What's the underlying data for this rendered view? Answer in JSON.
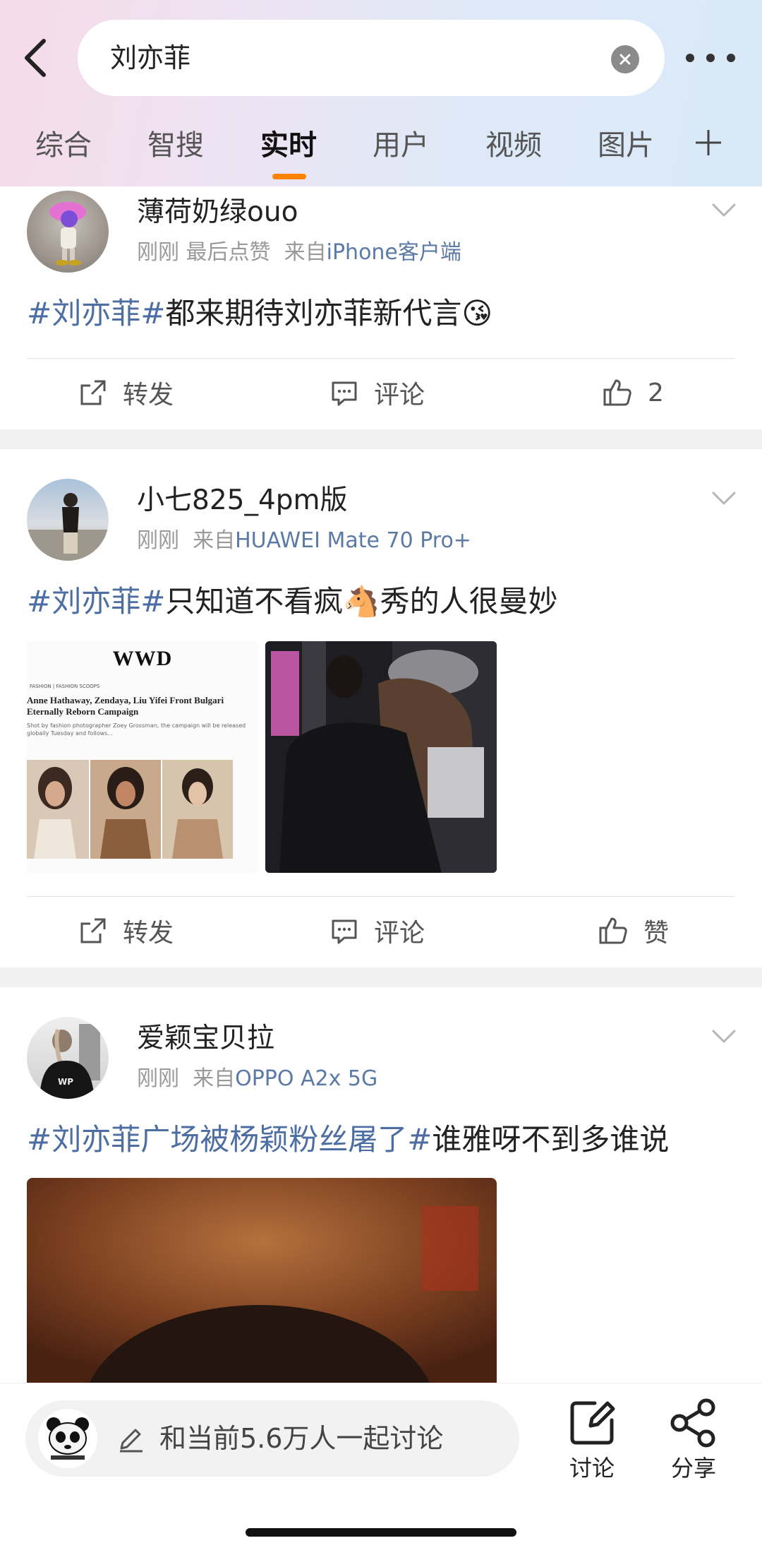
{
  "search": {
    "query": "刘亦菲"
  },
  "tabs": [
    {
      "label": "综合"
    },
    {
      "label": "智搜"
    },
    {
      "label": "实时"
    },
    {
      "label": "用户"
    },
    {
      "label": "视频"
    },
    {
      "label": "图片"
    }
  ],
  "accent_color": "#ff8200",
  "topic_color": "#4c6ea2",
  "posts": [
    {
      "username": "薄荷奶绿ouo",
      "time": "刚刚",
      "extra": "最后点赞",
      "source_prefix": "来自",
      "source": "iPhone客户端",
      "topic": "#刘亦菲#",
      "text": "都来期待刘亦菲新代言😘",
      "repost_label": "转发",
      "comment_label": "评论",
      "like_label": "2"
    },
    {
      "username": "小七825_4pm版",
      "time": "刚刚",
      "source_prefix": "来自",
      "source": "HUAWEI Mate 70 Pro+",
      "topic": "#刘亦菲#",
      "text": "只知道不看疯🐴秀的人很曼妙",
      "image1": {
        "brand": "WWD",
        "kicker": "FASHION | FASHION SCOOPS",
        "headline": "Anne Hathaway, Zendaya, Liu Yifei Front Bulgari Eternally Reborn Campaign",
        "dek": "Shot by fashion photographer Zoey Grossman, the campaign will be released globally Tuesday and follows..."
      },
      "repost_label": "转发",
      "comment_label": "评论",
      "like_label": "赞"
    },
    {
      "username": "爱颖宝贝拉",
      "time": "刚刚",
      "source_prefix": "来自",
      "source": "OPPO A2x 5G",
      "topic": "#刘亦菲广场被杨颖粉丝屠了#",
      "text": "谁雅呀不到多谁说"
    }
  ],
  "bottom": {
    "compose_placeholder": "和当前5.6万人一起讨论",
    "discuss_label": "讨论",
    "share_label": "分享"
  }
}
